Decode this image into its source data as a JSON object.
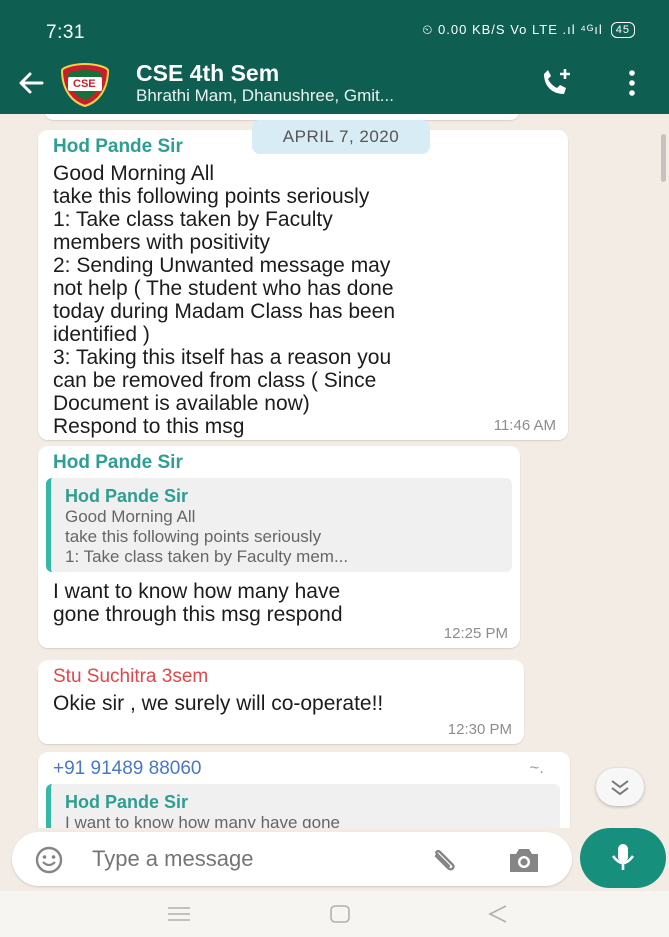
{
  "status_bar": {
    "time": "7:31",
    "icons_text": "⏲ 0.00 KB/S  Vo LTE  .ıl  ⁴ᴳıl",
    "battery": "45"
  },
  "app_bar": {
    "group_name": "CSE 4th Sem",
    "members": "Bhrathi Mam, Dhanushree, Gmit...",
    "avatar_text": "CSE"
  },
  "chat": {
    "date_chip": "APRIL 7, 2020",
    "messages": [
      {
        "sender": "Hod Pande Sir",
        "text": "Good Morning All\ntake this following points seriously\n1: Take class taken by Faculty\nmembers with positivity\n2: Sending Unwanted message may\nnot help ( The student who has done\ntoday during Madam Class has been\nidentified )\n3: Taking this itself has a reason you\ncan be removed from class ( Since\nDocument is available now)\nRespond to this msg",
        "time": "11:46 AM"
      },
      {
        "sender": "Hod Pande Sir",
        "quote_sender": "Hod Pande Sir",
        "quote_text": "Good Morning All\ntake this following points seriously\n1: Take class taken by Faculty mem...",
        "text": "I want to know how many have\ngone through this msg respond",
        "time": "12:25 PM"
      },
      {
        "sender": "Stu Suchitra 3sem",
        "text": "Okie sir , we surely will co-operate!!",
        "time": "12:30 PM"
      },
      {
        "sender": "+91 91489 88060",
        "sender_note": "~.",
        "quote_sender": "Hod Pande Sir",
        "quote_text": "I want to know how many have gone"
      }
    ]
  },
  "input": {
    "placeholder": "Type a message"
  },
  "colors": {
    "header": "#0f5e52",
    "chat_bg": "#f2ece4",
    "sender_teal": "#2f9e92",
    "sender_red": "#e0474c",
    "sender_blue": "#4a78c6",
    "mic_green": "#16907d"
  },
  "icons": [
    "back-arrow-icon",
    "add-call-icon",
    "more-options-icon",
    "emoji-icon",
    "attach-icon",
    "camera-icon",
    "mic-icon",
    "scroll-down-icon",
    "nav-menu-icon",
    "nav-home-icon",
    "nav-back-icon"
  ]
}
